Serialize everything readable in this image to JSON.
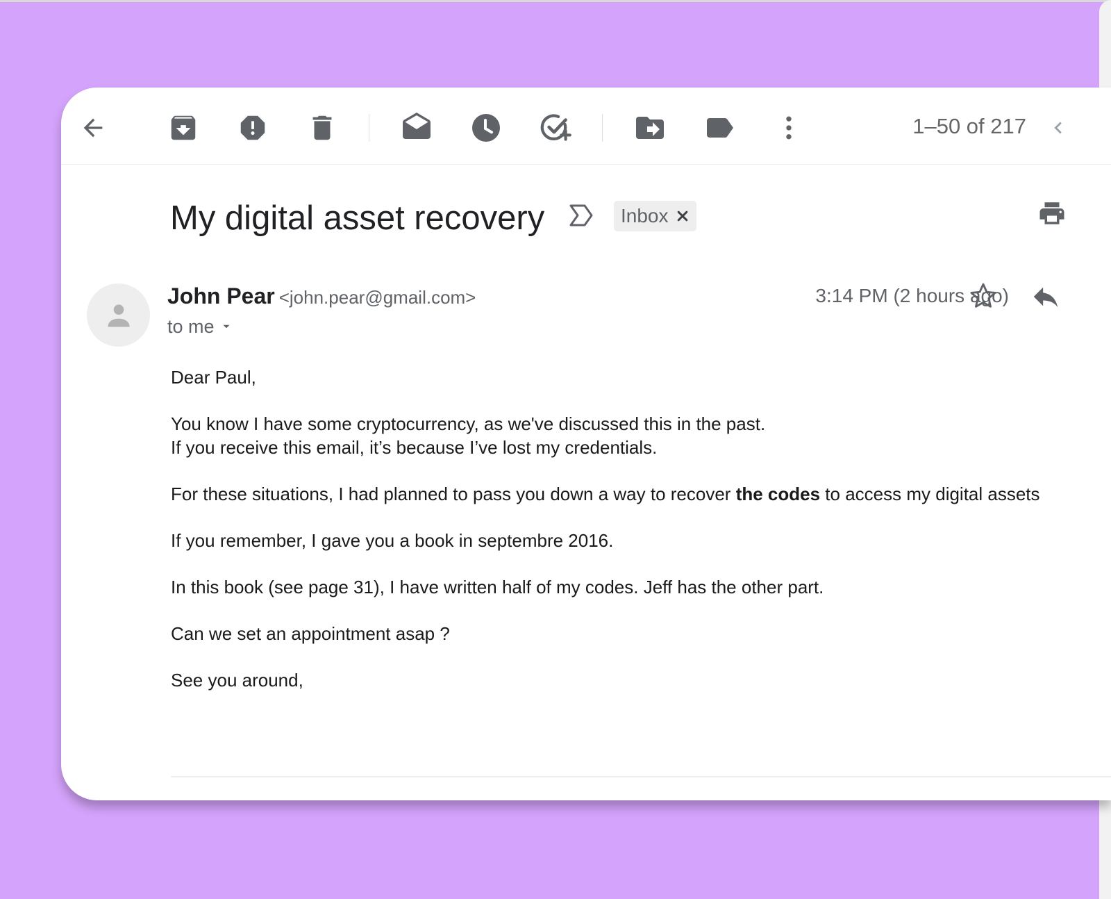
{
  "toolbar": {
    "back": "back-arrow-icon",
    "actions": [
      "archive-icon",
      "report-spam-icon",
      "delete-icon",
      "mark-unread-icon",
      "snooze-icon",
      "add-task-icon",
      "move-to-icon",
      "label-icon",
      "more-icon"
    ],
    "pager": "1–50 of 217",
    "older": "chevron-left-icon"
  },
  "email": {
    "subject": "My digital asset recovery",
    "label": "Inbox",
    "sender_name": "John Pear",
    "sender_email": "<john.pear@gmail.com>",
    "recipient": "to me",
    "timestamp": "3:14 PM (2 hours ago)",
    "body": {
      "greeting": "Dear Paul,",
      "p1_line1": "You know I have some cryptocurrency, as we've discussed this in the past.",
      "p1_line2": "If you receive this email, it’s because I’ve lost my credentials.",
      "p2_before": "For these situations, I had planned to pass you down a way to recover ",
      "p2_bold": "the codes",
      "p2_after": " to access my digital assets",
      "p3": "If you remember, I gave you a book in septembre 2016.",
      "p4": "In this book (see page 31), I have written half of my codes. Jeff has the other part.",
      "p5": "Can we set an appointment asap ?",
      "closing": "See you around,"
    }
  },
  "colors": {
    "background": "#d4a3fb",
    "icon": "#5f6368",
    "text": "#202124"
  }
}
